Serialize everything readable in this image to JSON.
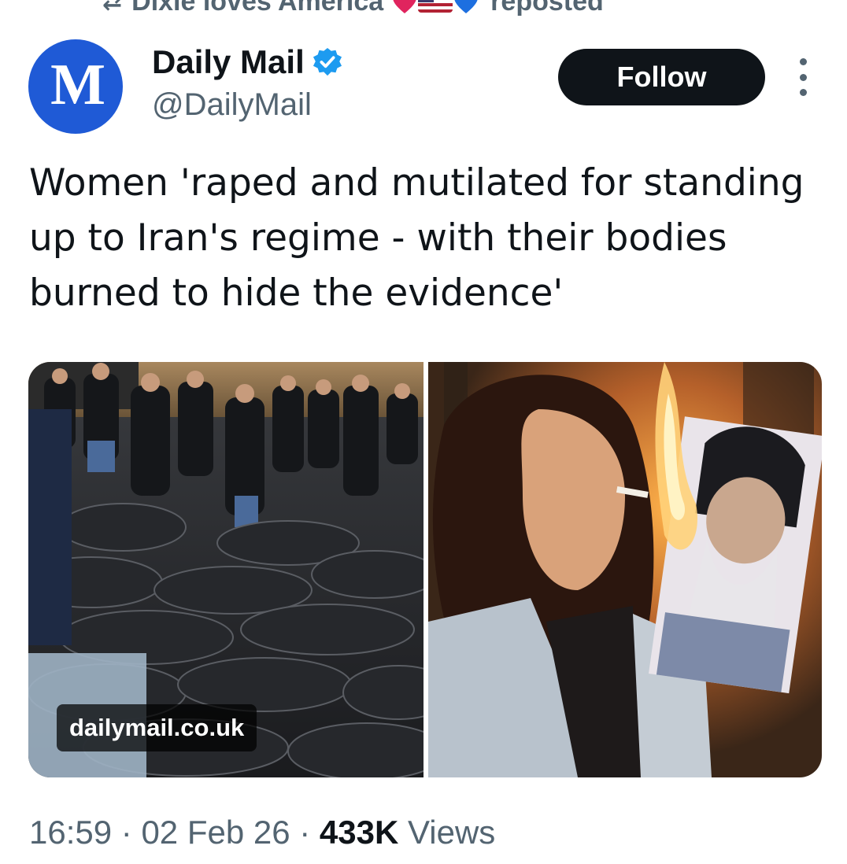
{
  "repost": {
    "user": "Dixie loves America",
    "suffix": "reposted"
  },
  "author": {
    "display_name": "Daily Mail",
    "handle": "@DailyMail",
    "verified": true,
    "avatar_mark": "M"
  },
  "follow_label": "Follow",
  "tweet": {
    "text": "Women 'raped and mutilated for standing up to Iran's regime - with their bodies burned to hide the evidence'"
  },
  "media": {
    "link_domain": "dailymail.co.uk"
  },
  "meta": {
    "time": "16:59",
    "date": "02 Feb 26",
    "views_count": "433K",
    "views_label": "Views"
  },
  "colors": {
    "accent": "#1d9bf0",
    "text_primary": "#0f1419",
    "text_secondary": "#536471",
    "avatar_bg": "#1f5ad6"
  }
}
